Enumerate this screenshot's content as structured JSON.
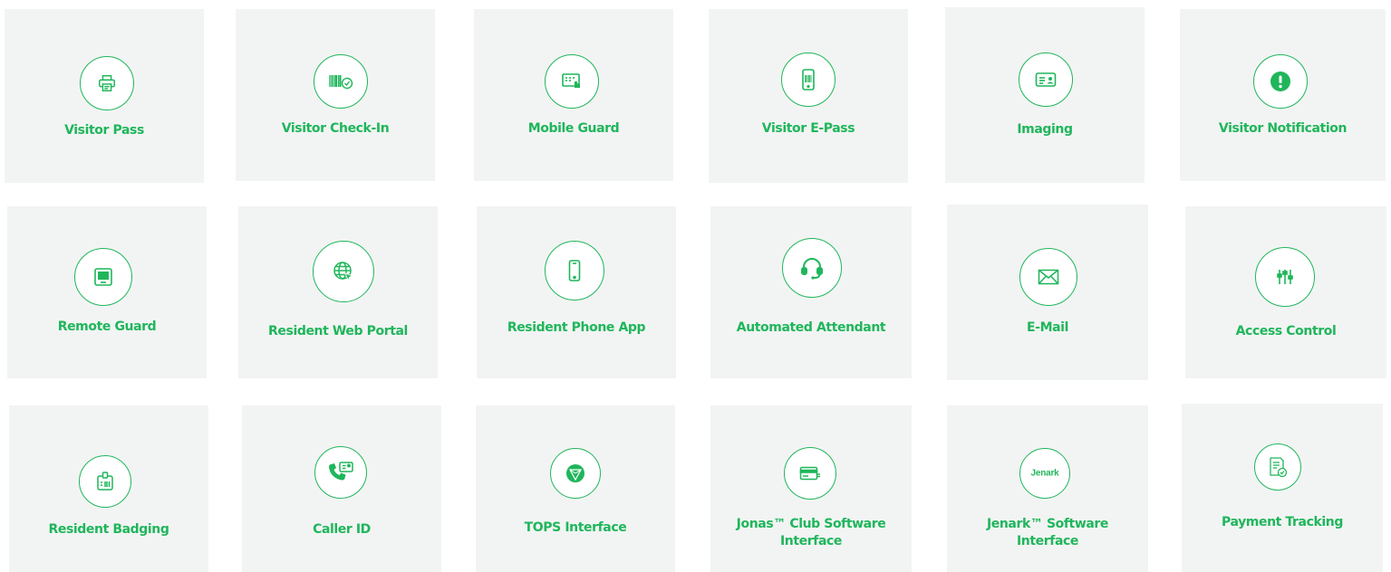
{
  "accent_color": "#1fb65b",
  "tile_color": "#f2f4f3",
  "features": [
    {
      "label": "Visitor Pass",
      "icon": "printer-icon"
    },
    {
      "label": "Visitor Check-In",
      "icon": "barcode-check-icon"
    },
    {
      "label": "Mobile Guard",
      "icon": "tablet-touch-icon"
    },
    {
      "label": "Visitor E-Pass",
      "icon": "phone-barcode-icon"
    },
    {
      "label": "Imaging",
      "icon": "id-card-icon"
    },
    {
      "label": "Visitor Notification",
      "icon": "exclamation-icon"
    },
    {
      "label": "Remote Guard",
      "icon": "monitor-icon"
    },
    {
      "label": "Resident Web Portal",
      "icon": "globe-cursor-icon"
    },
    {
      "label": "Resident Phone App",
      "icon": "smartphone-icon"
    },
    {
      "label": "Automated Attendant",
      "icon": "headset-icon"
    },
    {
      "label": "E-Mail",
      "icon": "envelope-icon"
    },
    {
      "label": "Access Control",
      "icon": "sliders-icon"
    },
    {
      "label": "Resident Badging",
      "icon": "badge-icon"
    },
    {
      "label": "Caller ID",
      "icon": "phone-id-icon"
    },
    {
      "label": "TOPS Interface",
      "icon": "tops-logo-icon"
    },
    {
      "label": "Jonas™ Club Software Interface",
      "icon": "credit-card-icon"
    },
    {
      "label": "Jenark™ Software Interface",
      "icon": "jenark-logo-icon",
      "logo_text": "Jenark"
    },
    {
      "label": "Payment Tracking",
      "icon": "receipt-check-icon"
    }
  ]
}
